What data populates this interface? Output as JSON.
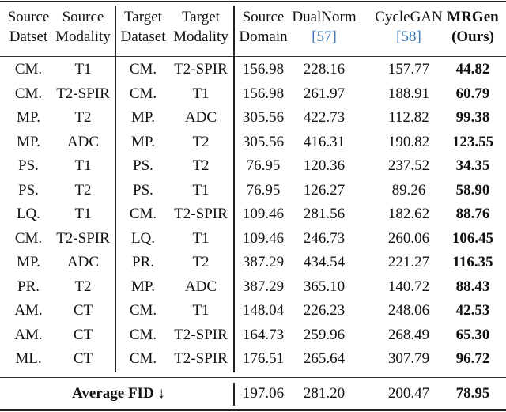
{
  "table": {
    "headers": [
      {
        "line1": "Source",
        "line2": "Datset"
      },
      {
        "line1": "Source",
        "line2": "Modality"
      },
      {
        "line1": "Target",
        "line2": "Dataset"
      },
      {
        "line1": "Target",
        "line2": "Modality"
      },
      {
        "line1": "Source",
        "line2": "Domain"
      },
      {
        "line1": "DualNorm",
        "line2": "[57]"
      },
      {
        "line1": "CycleGAN",
        "line2": "[58]"
      },
      {
        "line1": "MRGen",
        "line2": "(Ours)"
      }
    ],
    "rows": [
      [
        "CM.",
        "T1",
        "CM.",
        "T2-SPIR",
        "156.98",
        "228.16",
        "157.77",
        "44.82"
      ],
      [
        "CM.",
        "T2-SPIR",
        "CM.",
        "T1",
        "156.98",
        "261.97",
        "188.91",
        "60.79"
      ],
      [
        "MP.",
        "T2",
        "MP.",
        "ADC",
        "305.56",
        "422.73",
        "112.82",
        "99.38"
      ],
      [
        "MP.",
        "ADC",
        "MP.",
        "T2",
        "305.56",
        "416.31",
        "190.82",
        "123.55"
      ],
      [
        "PS.",
        "T1",
        "PS.",
        "T2",
        "76.95",
        "120.36",
        "237.52",
        "34.35"
      ],
      [
        "PS.",
        "T2",
        "PS.",
        "T1",
        "76.95",
        "126.27",
        "89.26",
        "58.90"
      ],
      [
        "LQ.",
        "T1",
        "CM.",
        "T2-SPIR",
        "109.46",
        "281.56",
        "182.62",
        "88.76"
      ],
      [
        "CM.",
        "T2-SPIR",
        "LQ.",
        "T1",
        "109.46",
        "246.73",
        "260.06",
        "106.45"
      ],
      [
        "MP.",
        "ADC",
        "PR.",
        "T2",
        "387.29",
        "434.54",
        "221.27",
        "116.35"
      ],
      [
        "PR.",
        "T2",
        "MP.",
        "ADC",
        "387.29",
        "365.10",
        "140.72",
        "88.43"
      ],
      [
        "AM.",
        "CT",
        "CM.",
        "T1",
        "148.04",
        "226.23",
        "248.06",
        "42.53"
      ],
      [
        "AM.",
        "CT",
        "CM.",
        "T2-SPIR",
        "164.73",
        "259.96",
        "268.49",
        "65.30"
      ],
      [
        "ML.",
        "CT",
        "CM.",
        "T2-SPIR",
        "176.51",
        "265.64",
        "307.79",
        "96.72"
      ]
    ],
    "average": {
      "label": "Average FID ↓",
      "values": [
        "197.06",
        "281.20",
        "200.47",
        "78.95"
      ]
    },
    "colors": {
      "citation": "#3d7ab5",
      "text": "#111111"
    }
  }
}
